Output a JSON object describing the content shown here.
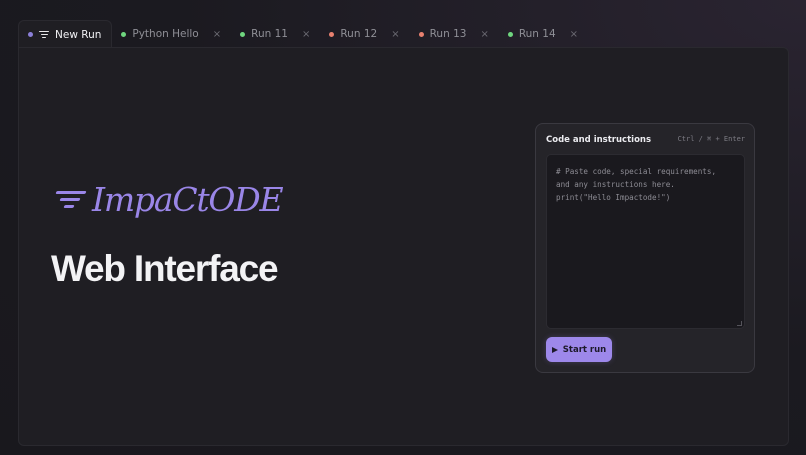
{
  "tabs": [
    {
      "label": "New Run",
      "active": true,
      "dot_color": "#8b7fd8",
      "icon": "wifi-icon",
      "closable": false
    },
    {
      "label": "Python Hello",
      "active": false,
      "dot_color": "#6fd67f",
      "closable": true
    },
    {
      "label": "Run 11",
      "active": false,
      "dot_color": "#6fd67f",
      "closable": true
    },
    {
      "label": "Run 12",
      "active": false,
      "dot_color": "#e8806f",
      "closable": true
    },
    {
      "label": "Run 13",
      "active": false,
      "dot_color": "#e8806f",
      "closable": true
    },
    {
      "label": "Run 14",
      "active": false,
      "dot_color": "#6fd67f",
      "closable": true
    }
  ],
  "close_glyph": "×",
  "hero": {
    "brand": "ImpaCtODE",
    "headline": "Web Interface",
    "brand_color": "#9a86e8",
    "logo_icon": "wifi-icon"
  },
  "card": {
    "title": "Code and instructions",
    "shortcut_hint": "Ctrl / ⌘ + Enter",
    "editor_lines": [
      "# Paste code, special requirements,",
      "and any instructions here.",
      "",
      "print(\"Hello Impactode!\")"
    ],
    "start_label": "Start run",
    "start_icon": "play-icon",
    "accent": "#9d88ea"
  }
}
